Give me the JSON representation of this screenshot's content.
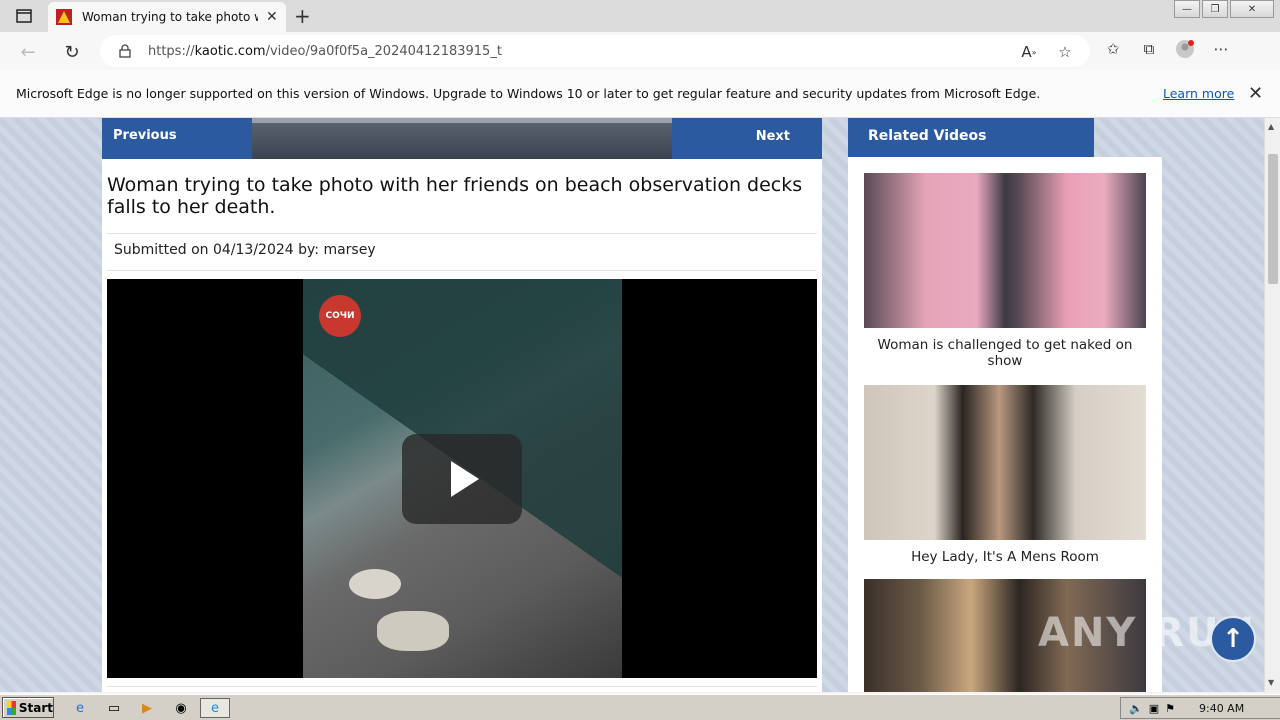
{
  "browser": {
    "tab_title": "Woman trying to take photo with",
    "url_prefix": "https://",
    "url_host": "kaotic.com",
    "url_path": "/video/9a0f0f5a_20240412183915_t",
    "window_controls": [
      "—",
      "❐",
      "✕"
    ]
  },
  "infobar": {
    "message": "Microsoft Edge is no longer supported on this version of Windows. Upgrade to Windows 10 or later to get regular feature and security updates from Microsoft Edge.",
    "link": "Learn more"
  },
  "video_page": {
    "prev_label": "Previous",
    "next_label": "Next",
    "title": "Woman trying to take photo with her friends on beach observation decks falls to her death.",
    "submitted": "Submitted on 04/13/2024 by:  marsey",
    "channel_logo": "СОЧИ"
  },
  "related": {
    "heading": "Related Videos",
    "items": [
      {
        "caption": "Woman is challenged to get naked on show"
      },
      {
        "caption": "Hey Lady, It's A Mens Room"
      },
      {
        "caption": ""
      }
    ]
  },
  "overlay": {
    "watermark": "ANY RUN"
  },
  "taskbar": {
    "start": "Start",
    "clock": "9:40 AM"
  }
}
